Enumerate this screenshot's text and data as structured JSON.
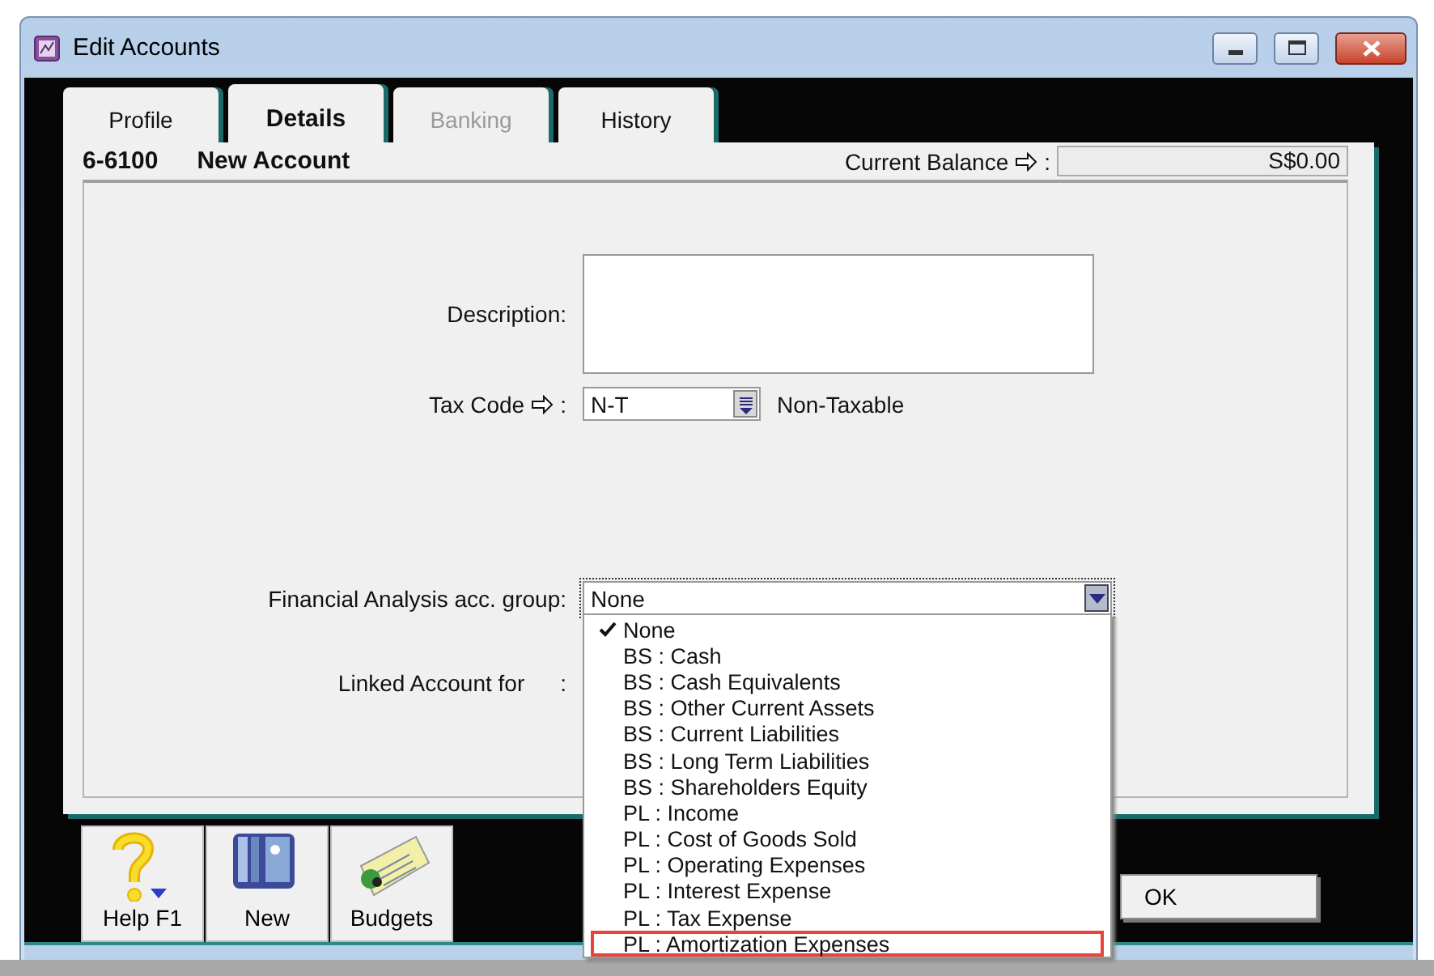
{
  "window": {
    "title": "Edit Accounts"
  },
  "tabs": [
    {
      "label": "Profile",
      "selected": false,
      "disabled": false
    },
    {
      "label": "Details",
      "selected": true,
      "disabled": false
    },
    {
      "label": "Banking",
      "selected": false,
      "disabled": true
    },
    {
      "label": "History",
      "selected": false,
      "disabled": false
    }
  ],
  "account": {
    "number": "6-6100",
    "name": "New Account"
  },
  "current_balance": {
    "label": "Current Balance",
    "suffix": ":",
    "value": "S$0.00"
  },
  "form": {
    "description_label": "Description:",
    "tax_code": {
      "label": "Tax Code",
      "suffix": ":",
      "value": "N-T",
      "description": "Non-Taxable"
    },
    "fa_group": {
      "label": "Financial Analysis acc. group:",
      "value": "None",
      "expanded": true,
      "options": [
        {
          "label": "None",
          "checked": true,
          "highlighted": false
        },
        {
          "label": "BS : Cash",
          "checked": false,
          "highlighted": false
        },
        {
          "label": "BS : Cash Equivalents",
          "checked": false,
          "highlighted": false
        },
        {
          "label": "BS : Other Current Assets",
          "checked": false,
          "highlighted": false
        },
        {
          "label": "BS : Current Liabilities",
          "checked": false,
          "highlighted": false
        },
        {
          "label": "BS : Long Term Liabilities",
          "checked": false,
          "highlighted": false
        },
        {
          "label": "BS : Shareholders Equity",
          "checked": false,
          "highlighted": false
        },
        {
          "label": "PL : Income",
          "checked": false,
          "highlighted": false
        },
        {
          "label": "PL : Cost of Goods Sold",
          "checked": false,
          "highlighted": false
        },
        {
          "label": "PL : Operating Expenses",
          "checked": false,
          "highlighted": false
        },
        {
          "label": "PL : Interest Expense",
          "checked": false,
          "highlighted": false
        },
        {
          "label": "PL : Tax Expense",
          "checked": false,
          "highlighted": false
        },
        {
          "label": "PL : Amortization Expenses",
          "checked": false,
          "highlighted": true
        }
      ]
    },
    "linked": {
      "label": "Linked Account for",
      "separator": ":"
    }
  },
  "toolbar": [
    {
      "label": "Help F1",
      "kind": "help"
    },
    {
      "label": "New",
      "kind": "new"
    },
    {
      "label": "Budgets",
      "kind": "budgets"
    }
  ],
  "ok_button": "OK"
}
